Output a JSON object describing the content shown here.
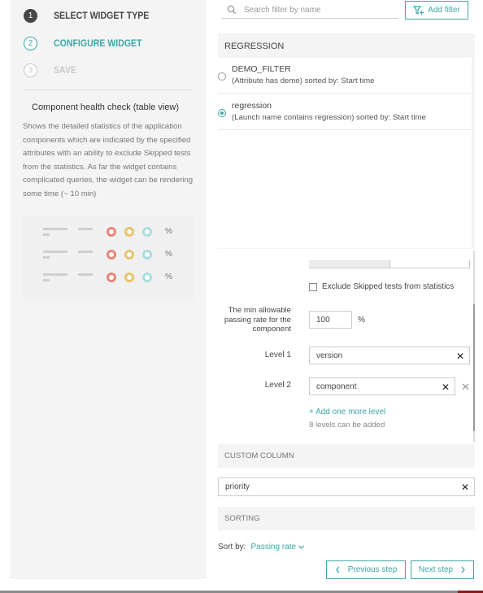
{
  "steps": [
    {
      "num": "1",
      "label": "SELECT WIDGET TYPE"
    },
    {
      "num": "2",
      "label": "CONFIGURE WIDGET"
    },
    {
      "num": "3",
      "label": "SAVE"
    }
  ],
  "widget": {
    "title": "Component health check (table view)",
    "description": "Shows the detailed statistics of the application components which are indicated by the specified attributes with an ability to exclude Skipped tests from the statistics. As far the widget contains complicated queries, the widget can be rendering some time (~ 10 min)",
    "preview_rows": [
      {
        "pct": "%"
      },
      {
        "pct": "%"
      },
      {
        "pct": "%"
      }
    ]
  },
  "filters": {
    "search_placeholder": "Search filter by name",
    "add_filter_label": "Add filter",
    "header": "REGRESSION",
    "items": [
      {
        "name": "DEMO_FILTER",
        "desc": "(Attribute has demo) sorted by: Start time",
        "selected": false
      },
      {
        "name": "regression",
        "desc": "(Launch name contains regression) sorted by: Start time",
        "selected": true
      }
    ]
  },
  "config": {
    "exclude_skipped_label": "Exclude Skipped tests from statistics",
    "min_rate_label": "The min allowable passing rate for the component",
    "min_rate_value": "100",
    "percent_sign": "%",
    "levels": [
      {
        "label": "Level 1",
        "value": "version"
      },
      {
        "label": "Level 2",
        "value": "component"
      }
    ],
    "add_level_label": "+ Add one more level",
    "levels_can_add": "8 levels can be added"
  },
  "custom_column": {
    "header": "CUSTOM COLUMN",
    "value": "priority"
  },
  "sorting": {
    "header": "SORTING",
    "sort_by_label": "Sort by:",
    "sort_by_value": "Passing rate"
  },
  "nav": {
    "prev_label": "Previous step",
    "next_label": "Next step"
  },
  "colors": {
    "accent": "#3fa6a6",
    "preview_red": "#e8857a",
    "preview_yellow": "#e8c36a",
    "preview_teal": "#a8dde0"
  }
}
